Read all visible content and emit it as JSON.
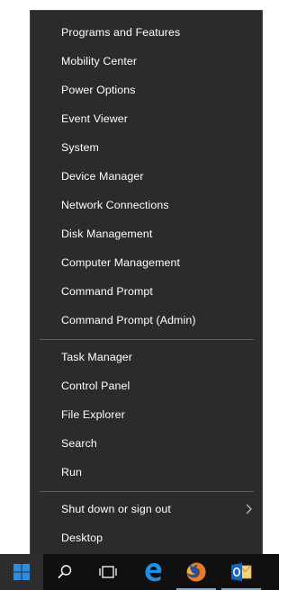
{
  "menu": {
    "group1": [
      {
        "label": "Programs and Features"
      },
      {
        "label": "Mobility Center"
      },
      {
        "label": "Power Options"
      },
      {
        "label": "Event Viewer"
      },
      {
        "label": "System"
      },
      {
        "label": "Device Manager"
      },
      {
        "label": "Network Connections"
      },
      {
        "label": "Disk Management"
      },
      {
        "label": "Computer Management"
      },
      {
        "label": "Command Prompt"
      },
      {
        "label": "Command Prompt (Admin)"
      }
    ],
    "group2": [
      {
        "label": "Task Manager"
      },
      {
        "label": "Control Panel"
      },
      {
        "label": "File Explorer"
      },
      {
        "label": "Search"
      },
      {
        "label": "Run"
      }
    ],
    "group3": [
      {
        "label": "Shut down or sign out",
        "submenu_icon": "chevron-right-icon"
      },
      {
        "label": "Desktop"
      }
    ]
  },
  "taskbar": {
    "items": [
      {
        "icon": "windows-start-icon",
        "active": true
      },
      {
        "icon": "search-icon"
      },
      {
        "icon": "task-view-icon"
      },
      {
        "icon": "edge-browser-icon"
      },
      {
        "icon": "firefox-icon"
      },
      {
        "icon": "outlook-icon"
      }
    ]
  },
  "colors": {
    "menu_background": "#2b2b2b",
    "menu_text": "#ffffff",
    "separator": "#5d5d5d",
    "taskbar_background": "#101010",
    "windows_blue": "#2b8de0"
  }
}
